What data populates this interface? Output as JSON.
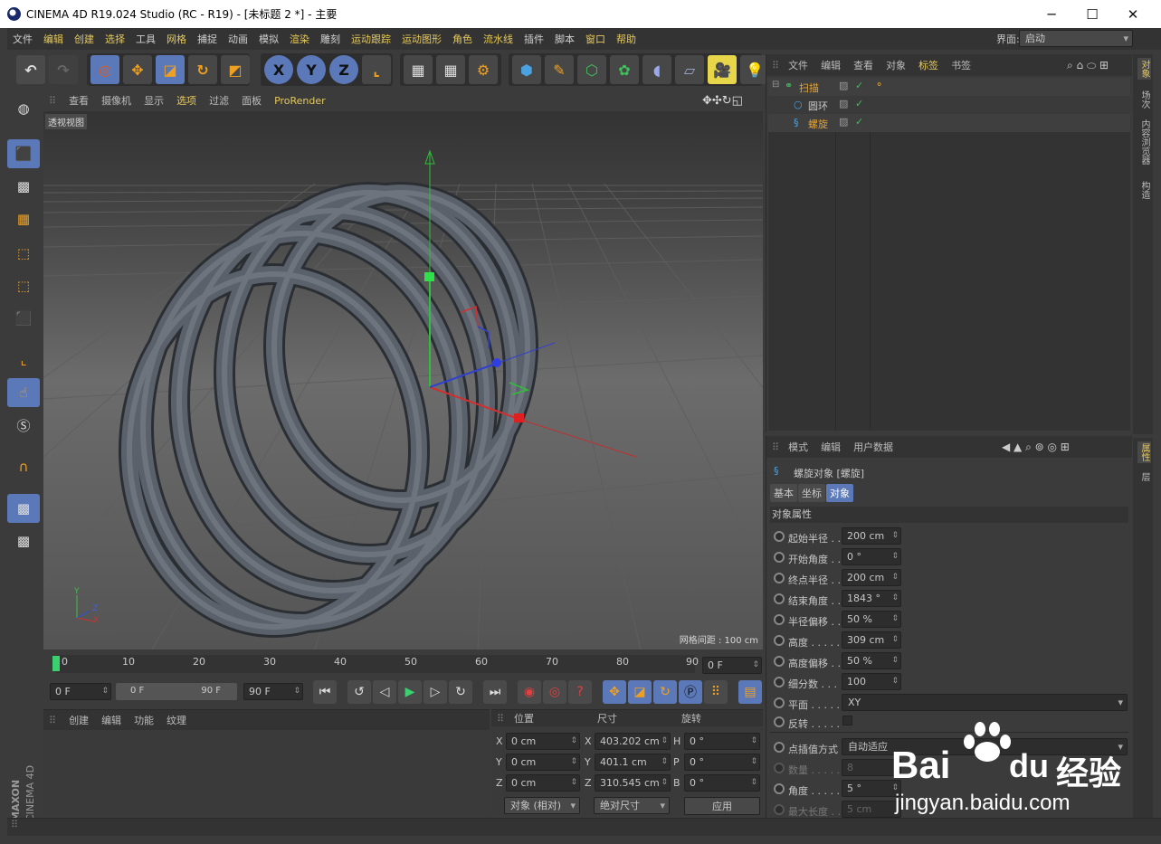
{
  "window": {
    "title": "CINEMA 4D R19.024 Studio (RC - R19) - [未标题 2 *] - 主要",
    "minimize": "─",
    "maximize": "☐",
    "close": "✕"
  },
  "menubar": {
    "items": [
      "文件",
      "编辑",
      "创建",
      "选择",
      "工具",
      "网格",
      "捕捉",
      "动画",
      "模拟",
      "渲染",
      "雕刻",
      "运动跟踪",
      "运动图形",
      "角色",
      "流水线",
      "插件",
      "脚本",
      "窗口",
      "帮助"
    ],
    "layout_label": "界面:",
    "layout_value": "启动"
  },
  "viewport": {
    "menu": [
      "查看",
      "摄像机",
      "显示",
      "选项",
      "过滤",
      "面板",
      "ProRender"
    ],
    "label": "透视视图",
    "grid_spacing": "网格间距 : 100 cm",
    "axis_y": "Y",
    "axis_z": "Z",
    "axis_x": "X"
  },
  "timeline": {
    "ticks": [
      "0",
      "10",
      "20",
      "30",
      "40",
      "50",
      "60",
      "70",
      "80",
      "90"
    ],
    "current_frame": "0 F",
    "start_field": "0 F",
    "range_start": "0 F",
    "range_end": "90 F",
    "end_field": "90 F"
  },
  "material_panel": {
    "menu": [
      "创建",
      "编辑",
      "功能",
      "纹理"
    ]
  },
  "coords": {
    "headers": [
      "位置",
      "尺寸",
      "旋转"
    ],
    "rows": [
      {
        "axis": "X",
        "pos": "0 cm",
        "size_axis": "X",
        "size": "403.202 cm",
        "rot_axis": "H",
        "rot": "0 °"
      },
      {
        "axis": "Y",
        "pos": "0 cm",
        "size_axis": "Y",
        "size": "401.1 cm",
        "rot_axis": "P",
        "rot": "0 °"
      },
      {
        "axis": "Z",
        "pos": "0 cm",
        "size_axis": "Z",
        "size": "310.545 cm",
        "rot_axis": "B",
        "rot": "0 °"
      }
    ],
    "mode": "对象 (相对)",
    "size_mode": "绝对尺寸",
    "apply": "应用"
  },
  "object_manager": {
    "menu": [
      "文件",
      "编辑",
      "查看",
      "对象",
      "标签",
      "书签"
    ],
    "objects": [
      {
        "name": "扫描",
        "color": "#e2a33a"
      },
      {
        "name": "圆环",
        "color": "#c8c8c8"
      },
      {
        "name": "螺旋",
        "color": "#e2a33a"
      }
    ]
  },
  "right_tabs": [
    "对象",
    "场次",
    "内容浏览器",
    "构造"
  ],
  "right_tabs_bottom": [
    "属性",
    "层"
  ],
  "attributes": {
    "menu": [
      "模式",
      "编辑",
      "用户数据"
    ],
    "object_title": "螺旋对象 [螺旋]",
    "tabs": [
      "基本",
      "坐标",
      "对象"
    ],
    "section": "对象属性",
    "props": [
      {
        "label": "起始半径 . .",
        "value": "200 cm"
      },
      {
        "label": "开始角度 . .",
        "value": "0 °"
      },
      {
        "label": "终点半径 . .",
        "value": "200 cm"
      },
      {
        "label": "结束角度 . .",
        "value": "1843 °"
      },
      {
        "label": "半径偏移 . .",
        "value": "50 %"
      },
      {
        "label": "高度 . . . . .",
        "value": "309 cm"
      },
      {
        "label": "高度偏移 . .",
        "value": "50 %"
      },
      {
        "label": "细分数 . . .",
        "value": "100"
      }
    ],
    "plane_label": "平面 . . . . .",
    "plane_value": "XY",
    "reverse_label": "反转 . . . . .",
    "interp_label": "点插值方式",
    "interp_value": "自动适应",
    "count_label": "数量 . . . . .",
    "count_value": "8",
    "angle_label": "角度 . . . . .",
    "angle_value": "5 °",
    "maxlen_label": "最大长度 . .",
    "maxlen_value": "5 cm"
  },
  "branding": {
    "maxon": "MAXON",
    "c4d": "CINEMA 4D"
  },
  "watermark": {
    "brand": "Bai",
    "brand2": "du",
    "suffix": "经验",
    "url": "jingyan.baidu.com"
  }
}
